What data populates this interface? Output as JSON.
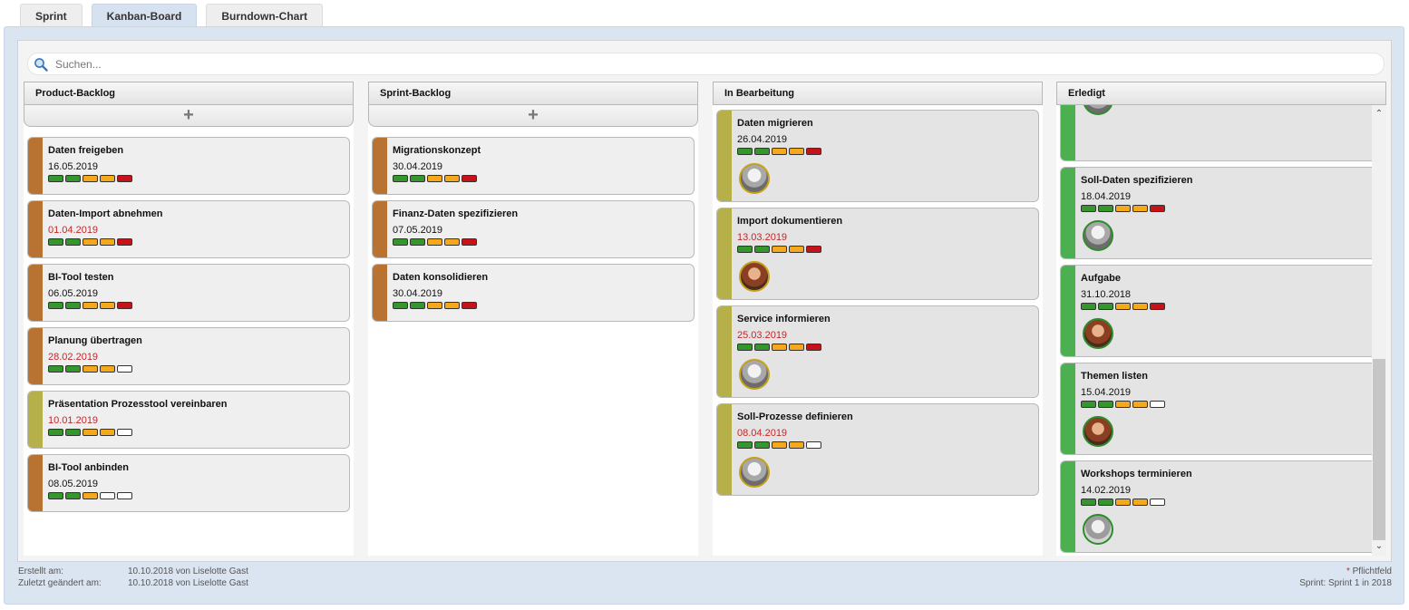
{
  "tabs": [
    {
      "label": "Sprint"
    },
    {
      "label": "Kanban-Board"
    },
    {
      "label": "Burndown-Chart"
    }
  ],
  "search": {
    "placeholder": "Suchen..."
  },
  "columns": [
    {
      "title": "Product-Backlog",
      "add_label": "+",
      "cards": [
        {
          "title": "Daten freigeben",
          "date": "16.05.2019",
          "overdue": false,
          "stripe": "#b87333",
          "pills": [
            "g",
            "g",
            "o",
            "o",
            "r"
          ]
        },
        {
          "title": "Daten-Import abnehmen",
          "date": "01.04.2019",
          "overdue": true,
          "stripe": "#b87333",
          "pills": [
            "g",
            "g",
            "o",
            "o",
            "r"
          ]
        },
        {
          "title": "BI-Tool testen",
          "date": "06.05.2019",
          "overdue": false,
          "stripe": "#b87333",
          "pills": [
            "g",
            "g",
            "o",
            "o",
            "r"
          ]
        },
        {
          "title": "Planung übertragen",
          "date": "28.02.2019",
          "overdue": true,
          "stripe": "#b87333",
          "pills": [
            "g",
            "g",
            "o",
            "o",
            "e"
          ]
        },
        {
          "title": "Präsentation Prozesstool vereinbaren",
          "date": "10.01.2019",
          "overdue": true,
          "stripe": "#b5b04a",
          "pills": [
            "g",
            "g",
            "o",
            "o",
            "e"
          ]
        },
        {
          "title": "BI-Tool anbinden",
          "date": "08.05.2019",
          "overdue": false,
          "stripe": "#b87333",
          "pills": [
            "g",
            "g",
            "o",
            "e",
            "e"
          ]
        }
      ]
    },
    {
      "title": "Sprint-Backlog",
      "add_label": "+",
      "cards": [
        {
          "title": "Migrationskonzept",
          "date": "30.04.2019",
          "overdue": false,
          "stripe": "#b87333",
          "pills": [
            "g",
            "g",
            "o",
            "o",
            "r"
          ]
        },
        {
          "title": "Finanz-Daten spezifizieren",
          "date": "07.05.2019",
          "overdue": false,
          "stripe": "#b87333",
          "pills": [
            "g",
            "g",
            "o",
            "o",
            "r"
          ]
        },
        {
          "title": "Daten konsolidieren",
          "date": "30.04.2019",
          "overdue": false,
          "stripe": "#b87333",
          "pills": [
            "g",
            "g",
            "o",
            "o",
            "r"
          ]
        }
      ]
    },
    {
      "title": "In Bearbeitung",
      "cards": [
        {
          "title": "Daten migrieren",
          "date": "26.04.2019",
          "overdue": false,
          "stripe": "#b5b04a",
          "pills": [
            "g",
            "g",
            "o",
            "o",
            "r"
          ],
          "avatar": "gray"
        },
        {
          "title": "Import dokumentieren",
          "date": "13.03.2019",
          "overdue": true,
          "stripe": "#b5b04a",
          "pills": [
            "g",
            "g",
            "o",
            "o",
            "r"
          ],
          "avatar": "warm"
        },
        {
          "title": "Service informieren",
          "date": "25.03.2019",
          "overdue": true,
          "stripe": "#b5b04a",
          "pills": [
            "g",
            "g",
            "o",
            "o",
            "r"
          ],
          "avatar": "gray"
        },
        {
          "title": "Soll-Prozesse definieren",
          "date": "08.04.2019",
          "overdue": true,
          "stripe": "#b5b04a",
          "pills": [
            "g",
            "g",
            "o",
            "o",
            "e"
          ],
          "avatar": "gray"
        }
      ]
    },
    {
      "title": "Erledigt",
      "cards": [
        {
          "title": "",
          "date": "",
          "overdue": false,
          "stripe": "#4caf50",
          "pills": [
            "g",
            "g",
            "o",
            "o",
            "r"
          ],
          "avatar": "gray"
        },
        {
          "title": "Soll-Daten spezifizieren",
          "date": "18.04.2019",
          "overdue": false,
          "stripe": "#4caf50",
          "pills": [
            "g",
            "g",
            "o",
            "o",
            "r"
          ],
          "avatar": "gray"
        },
        {
          "title": "Aufgabe",
          "date": "31.10.2018",
          "overdue": false,
          "stripe": "#4caf50",
          "pills": [
            "g",
            "g",
            "o",
            "o",
            "r"
          ],
          "avatar": "warm"
        },
        {
          "title": "Themen listen",
          "date": "15.04.2019",
          "overdue": false,
          "stripe": "#4caf50",
          "pills": [
            "g",
            "g",
            "o",
            "o",
            "e"
          ],
          "avatar": "warm"
        },
        {
          "title": "Workshops terminieren",
          "date": "14.02.2019",
          "overdue": false,
          "stripe": "#4caf50",
          "pills": [
            "g",
            "g",
            "o",
            "o",
            "e"
          ],
          "avatar": "neutral"
        }
      ]
    }
  ],
  "footer": {
    "created_label": "Erstellt am:",
    "created_value": "10.10.2018 von Liselotte Gast",
    "changed_label": "Zuletzt geändert am:",
    "changed_value": "10.10.2018 von Liselotte Gast",
    "required_star": "*",
    "required_label": "Pflichtfeld",
    "sprint_label": "Sprint: Sprint 1 in 2018"
  },
  "colors": {
    "overdue": "#c0282a",
    "stripe_brown": "#b87333",
    "stripe_olive": "#b5b04a",
    "stripe_green": "#4caf50"
  }
}
